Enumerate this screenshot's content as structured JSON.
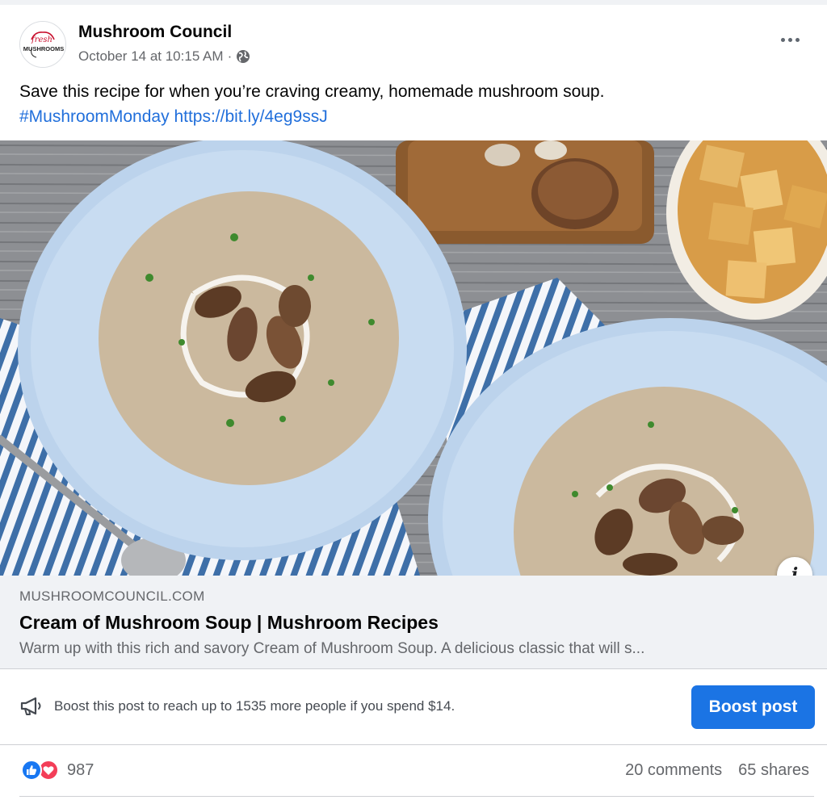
{
  "post": {
    "page_name": "Mushroom Council",
    "timestamp": "October 14 at 10:15 AM",
    "separator": "·",
    "audience_icon": "globe-icon",
    "avatar_logo": {
      "line1": "fresh",
      "line2": "MUSHROOMS"
    },
    "text": "Save this recipe for when you’re craving creamy, homemade mushroom soup.",
    "hashtag": "#MushroomMonday",
    "url": "https://bit.ly/4eg9ssJ"
  },
  "media": {
    "alt": "Cream of mushroom soup served in blue scalloped bowls",
    "info_icon": "i"
  },
  "link_card": {
    "domain": "MUSHROOMCOUNCIL.COM",
    "title": "Cream of Mushroom Soup | Mushroom Recipes",
    "description": "Warm up with this rich and savory Cream of Mushroom Soup. A delicious classic that will s..."
  },
  "boost": {
    "icon": "megaphone-icon",
    "text": "Boost this post to reach up to 1535 more people if you spend $14.",
    "button_label": "Boost post"
  },
  "stats": {
    "reaction_icons": [
      "like-icon",
      "love-icon"
    ],
    "reaction_count": "987",
    "comments": "20 comments",
    "shares": "65 shares"
  },
  "colors": {
    "link": "#216fdb",
    "boost_button": "#1b74e4",
    "like": "#1877f2",
    "love": "#f33e58",
    "secondary_text": "#65676b"
  }
}
